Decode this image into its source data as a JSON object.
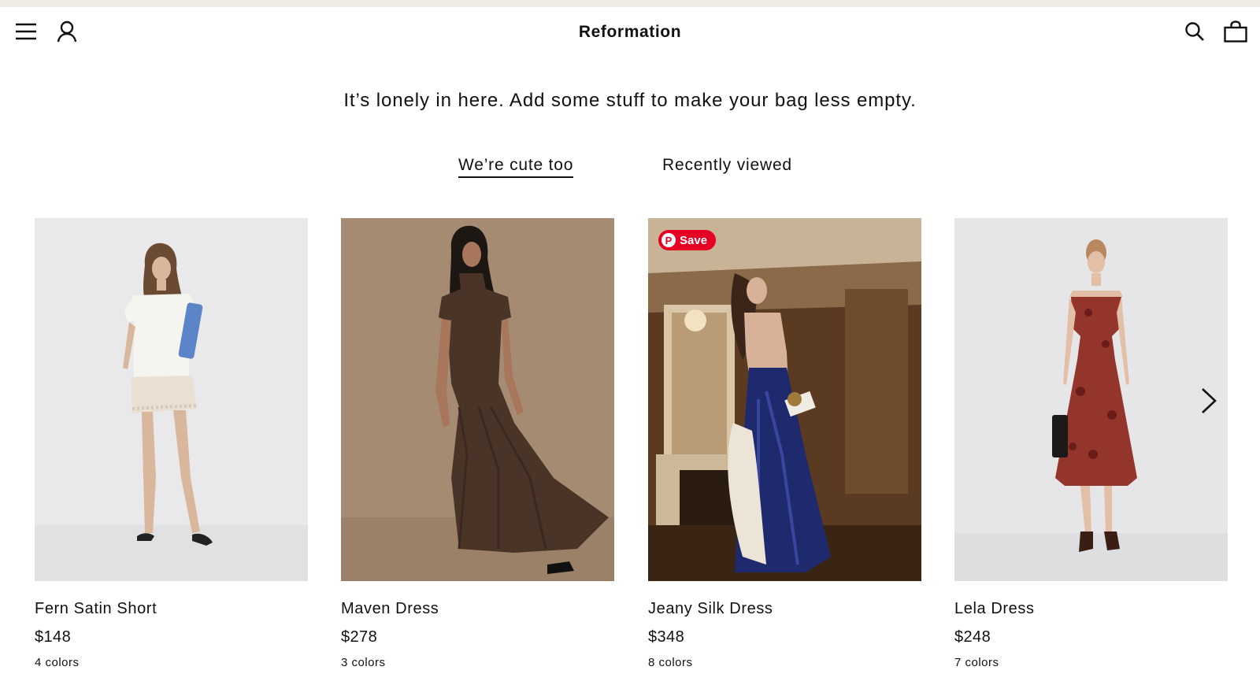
{
  "header": {
    "brand": "Reformation",
    "icons": {
      "menu": "hamburger-menu-icon",
      "account": "user-icon",
      "search": "search-icon",
      "bag": "shopping-bag-icon"
    }
  },
  "bag": {
    "empty_message": "It’s lonely in here. Add some stuff to make your bag less empty."
  },
  "tabs": [
    {
      "label": "We’re cute too",
      "active": true
    },
    {
      "label": "Recently viewed",
      "active": false
    }
  ],
  "products": [
    {
      "name": "Fern Satin Short",
      "price": "$148",
      "colors": "4 colors"
    },
    {
      "name": "Maven Dress",
      "price": "$278",
      "colors": "3 colors"
    },
    {
      "name": "Jeany Silk Dress",
      "price": "$348",
      "colors": "8 colors",
      "pin_save": "Save"
    },
    {
      "name": "Lela Dress",
      "price": "$248",
      "colors": "7 colors"
    }
  ],
  "carousel": {
    "next_icon": "chevron-right-icon"
  },
  "colors": {
    "pinterest": "#e60023",
    "top_strip": "#efebe2",
    "text": "#111111"
  }
}
